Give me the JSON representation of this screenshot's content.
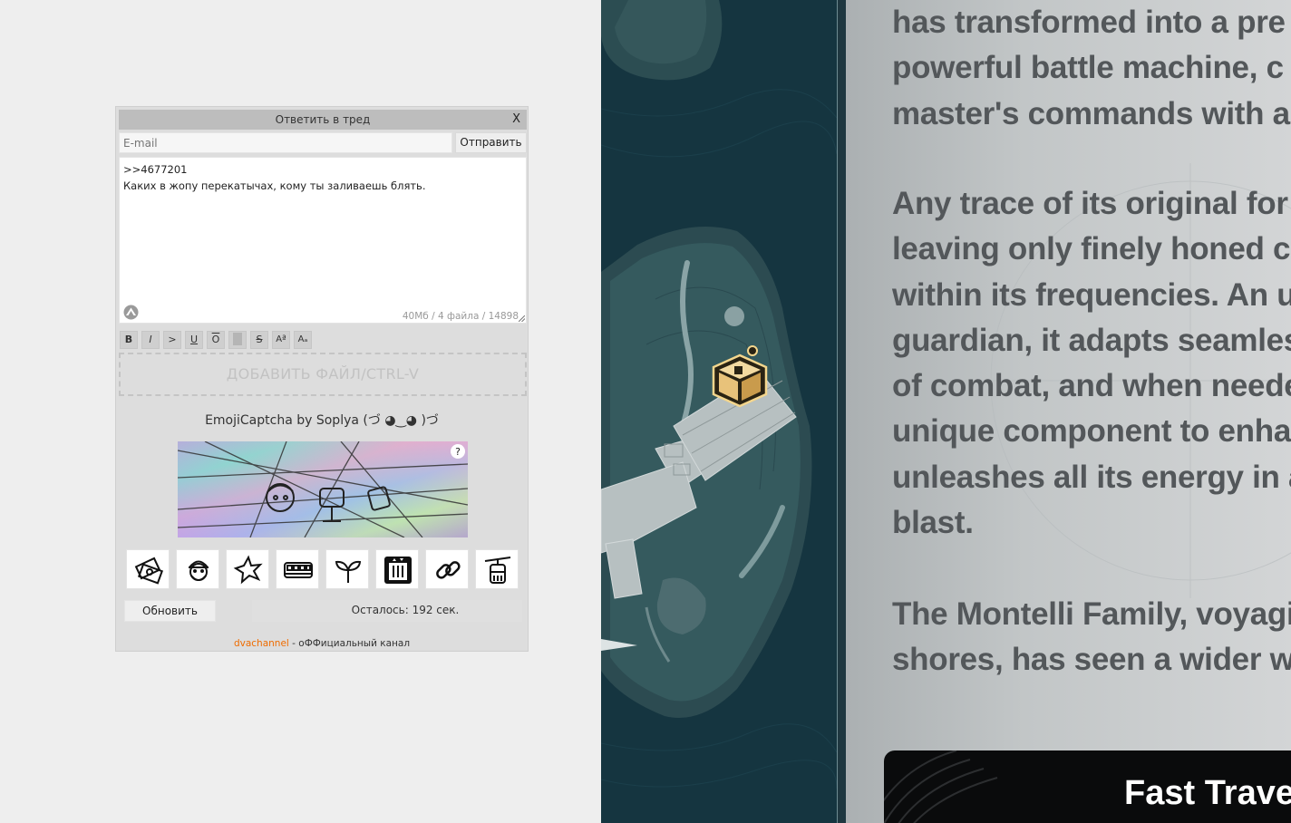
{
  "reply_form": {
    "title": "Ответить в тред",
    "close_label": "X",
    "email_placeholder": "E-mail",
    "send_label": "Отправить",
    "message_lines": [
      ">>4677201",
      "Каких в жопу перекатычах, кому ты заливаешь блять."
    ],
    "limits": "40Мб / 4 файла / 14898",
    "toolbar": [
      {
        "label": "B",
        "name": "bold-button"
      },
      {
        "label": "I",
        "name": "italic-button"
      },
      {
        "label": ">",
        "name": "quote-button"
      },
      {
        "label": "U",
        "name": "underline-button"
      },
      {
        "label": "O",
        "name": "overline-button"
      },
      {
        "label": "",
        "name": "spoiler-button"
      },
      {
        "label": "S",
        "name": "strike-button"
      },
      {
        "label": "Aª",
        "name": "superscript-button"
      },
      {
        "label": "Aₐ",
        "name": "subscript-button"
      }
    ],
    "file_drop_label": "ДОБАВИТЬ ФАЙЛ/CTRL-V",
    "captcha": {
      "title": "EmojiCaptcha by Soplya (づ ◕‿◕ )づ",
      "help_label": "?",
      "emoji_options": [
        "money-icon",
        "santa-icon",
        "star-icon",
        "tram-icon",
        "sprout-icon",
        "elevator-icon",
        "link-icon",
        "cable-car-icon"
      ],
      "refresh_label": "Обновить",
      "time_left": "Осталось: 192 сек."
    },
    "footer": {
      "link_text": "dvachannel",
      "text": " - оФФициальный канал",
      "link_color": "#ef6c00"
    }
  },
  "lore_panel": {
    "paragraphs": [
      [
        "has transformed into a pre",
        "powerful battle machine, c",
        "master's commands with a"
      ],
      [
        "Any trace of its original for",
        "leaving only finely honed co",
        "within its frequencies. An u",
        "guardian, it adapts seamles",
        "of combat, and when neede",
        "unique component to enha",
        "unleashes all its energy in a",
        "blast."
      ],
      [
        "The Montelli Family, voyagi",
        "shores, has seen a wider wo"
      ]
    ],
    "fast_travel_label": "Fast Trave",
    "map_marker": "chest-icon"
  }
}
